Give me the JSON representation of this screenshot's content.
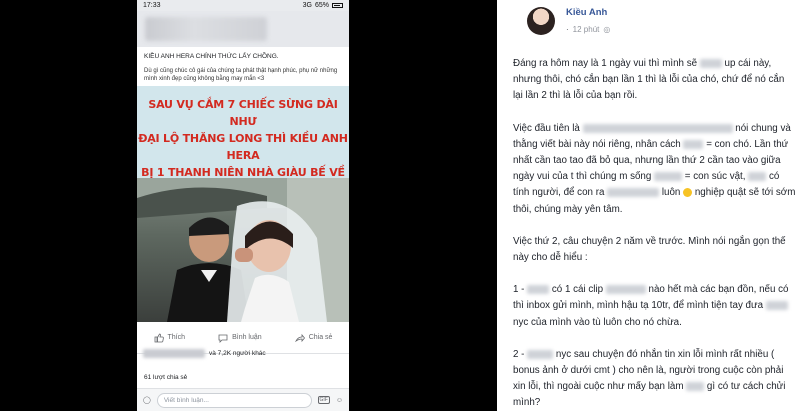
{
  "phone": {
    "status": {
      "time": "17:33",
      "network": "3G",
      "battery_pct": "65%"
    },
    "post": {
      "title": "KIỀU ANH HERA CHÍNH THỨC LẤY CHỒNG.",
      "desc": "Dù gì cũng chúc cô gái của chúng ta phát thật hạnh phúc, phụ nữ những mình xinh đẹp cũng không bằng may mắn <3"
    },
    "headline": [
      "SAU VỤ CẮM 7 CHIẾC SỪNG DÀI NHƯ",
      "ĐẠI LỘ THĂNG LONG THÌ KIỀU ANH HERA",
      "BỊ 1 THANH NIÊN NHÀ GIÀU BẾ VỀ LÀM VỢ"
    ],
    "actions": {
      "like": "Thích",
      "comment": "Bình luận",
      "share": "Chia sẻ"
    },
    "likes_text": "và 7,2K người khác",
    "shares_text": "61 lượt chia sẻ",
    "comment_placeholder": "Viết bình luận...",
    "gif_label": "GIF"
  },
  "post": {
    "author": "Kiều Anh",
    "time": "12 phút",
    "dots": "·",
    "p1": [
      "Đáng ra hôm nay là 1 ngày vui thì mình sẽ ",
      " up cái này, nhưng thôi, chó cắn bạn lần 1 thì là lỗi của chó, chứ để nó cắn lại lần 2 thì là lỗi của bạn rồi."
    ],
    "p2": [
      "Việc đầu tiên là ",
      " nói chung và thằng viết bài này nói riêng, nhân cách ",
      " = con chó. Lần thứ nhất cần tao tao đã bỏ qua, nhưng lần thứ 2 cần tao vào giữa ngày vui của t thì chúng m sống ",
      " = con súc vật, ",
      " có tính người, để con ra ",
      " luôn ",
      " nghiệp quật sẽ tới sớm thôi, chúng mày yên tâm."
    ],
    "p3": "Việc thứ 2, câu chuyện 2 năm về trước. Mình nói ngắn gọn thế này cho dễ hiểu :",
    "p4": [
      "1 - ",
      " có 1 cái clip ",
      " nào hết mà các bạn đồn, nếu có thì inbox gửi mình, mình hậu tạ 10tr, để mình tiện tay đưa ",
      " nyc của mình vào tù luôn cho nó chừa."
    ],
    "p5": [
      "2 - ",
      " nyc sau chuyện đó nhắn tin xin lỗi mình rất nhiều ( bonus ảnh ở dưới cmt ) cho nên là, người trong cuộc còn phải xin lỗi, thì ngoài cuộc như mấy bạn làm ",
      " gì có tư cách chửi mình?"
    ]
  }
}
